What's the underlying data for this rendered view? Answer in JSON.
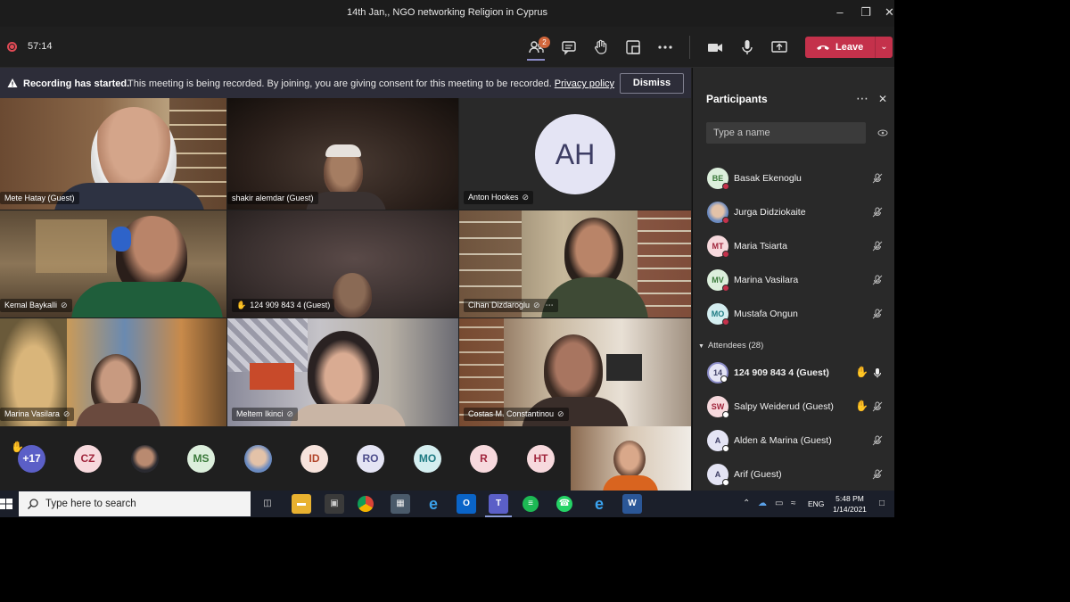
{
  "window": {
    "title": "14th Jan,, NGO networking Religion in Cyprus"
  },
  "toolbar": {
    "timer": "57:14",
    "people_badge": "2",
    "leave_label": "Leave"
  },
  "banner": {
    "title": "Recording has started.",
    "message": "This meeting is being recorded. By joining, you are giving consent for this meeting to be recorded.",
    "link": "Privacy policy",
    "dismiss_label": "Dismiss"
  },
  "tiles": [
    {
      "name": "Mete Hatay (Guest)"
    },
    {
      "name": "shakir alemdar (Guest)"
    },
    {
      "name": "Anton Hookes",
      "initials": "AH"
    },
    {
      "name": "Kemal Baykalli"
    },
    {
      "name": "124 909 843 4 (Guest)"
    },
    {
      "name": "Cihan Dizdaroglu"
    },
    {
      "name": "Marina Vasilara"
    },
    {
      "name": "Meltem Ikinci"
    },
    {
      "name": "Costas M. Constantinou"
    }
  ],
  "strip": {
    "overflow_count": "+17",
    "avatars": [
      "CZ",
      "MS",
      "ID",
      "RO",
      "MO",
      "R",
      "HT"
    ]
  },
  "panel": {
    "title": "Participants",
    "search_placeholder": "Type a name",
    "presenters": [
      {
        "initials": "BE",
        "name": "Basak Ekenoglu"
      },
      {
        "initials": "",
        "name": "Jurga Didziokaite"
      },
      {
        "initials": "MT",
        "name": "Maria Tsiarta"
      },
      {
        "initials": "MV",
        "name": "Marina Vasilara"
      },
      {
        "initials": "MO",
        "name": "Mustafa Ongun"
      }
    ],
    "attendees_header": "Attendees (28)",
    "attendees": [
      {
        "initials": "14",
        "name": "124 909 843 4 (Guest)"
      },
      {
        "initials": "SW",
        "name": "Salpy Weiderud (Guest)"
      },
      {
        "initials": "A",
        "name": "Alden & Marina (Guest)"
      },
      {
        "initials": "A",
        "name": "Arif (Guest)"
      }
    ]
  },
  "taskbar": {
    "search_placeholder": "Type here to search",
    "language": "ENG",
    "time": "5:48 PM",
    "date": "1/14/2021"
  }
}
